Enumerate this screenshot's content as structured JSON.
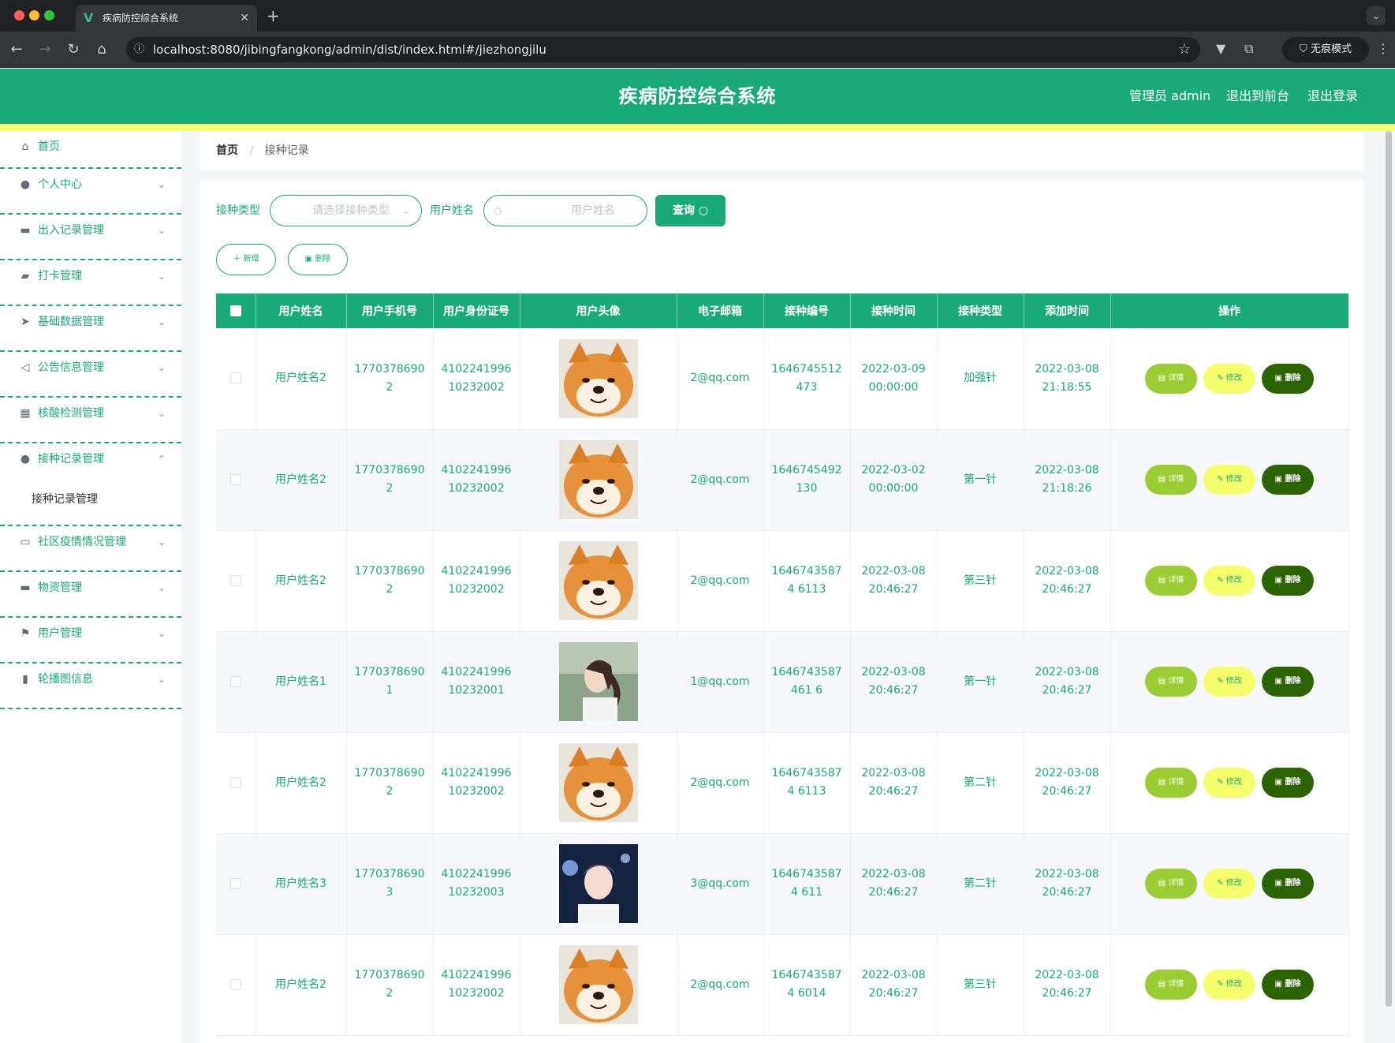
{
  "browser": {
    "tab_title": "疾病防控综合系统",
    "url": "localhost:8080/jibingfangkong/admin/dist/index.html#/jiezhongjilu",
    "incognito_label": "无痕模式"
  },
  "header": {
    "title": "疾病防控综合系统",
    "user_label": "管理员 admin",
    "front_link": "退出到前台",
    "logout_link": "退出登录"
  },
  "sidebar": {
    "items": [
      {
        "label": "首页",
        "icon": "home-icon"
      },
      {
        "label": "个人中心",
        "icon": "user-icon"
      },
      {
        "label": "出入记录管理",
        "icon": "printer-icon"
      },
      {
        "label": "打卡管理",
        "icon": "wallet-icon"
      },
      {
        "label": "基础数据管理",
        "icon": "send-icon"
      },
      {
        "label": "公告信息管理",
        "icon": "location-icon"
      },
      {
        "label": "核酸检测管理",
        "icon": "briefcase-icon"
      },
      {
        "label": "接种记录管理",
        "icon": "user-icon",
        "open": true,
        "sub": "接种记录管理"
      },
      {
        "label": "社区疫情情况管理",
        "icon": "chat-icon"
      },
      {
        "label": "物资管理",
        "icon": "message-icon"
      },
      {
        "label": "用户管理",
        "icon": "flag-icon"
      },
      {
        "label": "轮播图信息",
        "icon": "bar-chart-icon"
      }
    ]
  },
  "breadcrumb": {
    "home": "首页",
    "sep": "/",
    "current": "接种记录"
  },
  "search": {
    "type_label": "接种类型",
    "type_placeholder": "请选择接种类型",
    "name_label": "用户姓名",
    "name_placeholder": "用户姓名",
    "query_button": "查询"
  },
  "actions": {
    "add": "新增",
    "delete": "删除"
  },
  "table": {
    "columns": [
      "用户姓名",
      "用户手机号",
      "用户身份证号",
      "用户头像",
      "电子邮箱",
      "接种编号",
      "接种时间",
      "接种类型",
      "添加时间",
      "操作"
    ],
    "op_labels": {
      "detail": "详情",
      "edit": "修改",
      "delete": "删除"
    },
    "rows": [
      {
        "name": "用户姓名2",
        "phone": "17703786902",
        "idcard": "410224199610232002",
        "avatar": "shiba",
        "email": "2@qq.com",
        "code": "1646745512473",
        "vac_time": "2022-03-09 00:00:00",
        "type": "加强针",
        "added": "2022-03-08 21:18:55"
      },
      {
        "name": "用户姓名2",
        "phone": "17703786902",
        "idcard": "410224199610232002",
        "avatar": "shiba",
        "email": "2@qq.com",
        "code": "1646745492130",
        "vac_time": "2022-03-02 00:00:00",
        "type": "第一针",
        "added": "2022-03-08 21:18:26"
      },
      {
        "name": "用户姓名2",
        "phone": "17703786902",
        "idcard": "410224199610232002",
        "avatar": "shiba",
        "email": "2@qq.com",
        "code": "16467435874 6113",
        "vac_time": "2022-03-08 20:46:27",
        "type": "第三针",
        "added": "2022-03-08 20:46:27"
      },
      {
        "name": "用户姓名1",
        "phone": "17703786901",
        "idcard": "410224199610232001",
        "avatar": "girl",
        "email": "1@qq.com",
        "code": "1646743587461 6",
        "vac_time": "2022-03-08 20:46:27",
        "type": "第一针",
        "added": "2022-03-08 20:46:27"
      },
      {
        "name": "用户姓名2",
        "phone": "17703786902",
        "idcard": "410224199610232002",
        "avatar": "shiba",
        "email": "2@qq.com",
        "code": "16467435874 6113",
        "vac_time": "2022-03-08 20:46:27",
        "type": "第二针",
        "added": "2022-03-08 20:46:27"
      },
      {
        "name": "用户姓名3",
        "phone": "17703786903",
        "idcard": "410224199610232003",
        "avatar": "boy",
        "email": "3@qq.com",
        "code": "16467435874 611",
        "vac_time": "2022-03-08 20:46:27",
        "type": "第二针",
        "added": "2022-03-08 20:46:27"
      },
      {
        "name": "用户姓名2",
        "phone": "17703786902",
        "idcard": "410224199610232002",
        "avatar": "shiba",
        "email": "2@qq.com",
        "code": "16467435874 6014",
        "vac_time": "2022-03-08 20:46:27",
        "type": "第三针",
        "added": "2022-03-08 20:46:27"
      }
    ]
  },
  "colors": {
    "primary": "#1aaa7a",
    "accent_yellow": "#f4ff6a",
    "detail_green": "#9acd32",
    "delete_dark": "#2c6404"
  }
}
